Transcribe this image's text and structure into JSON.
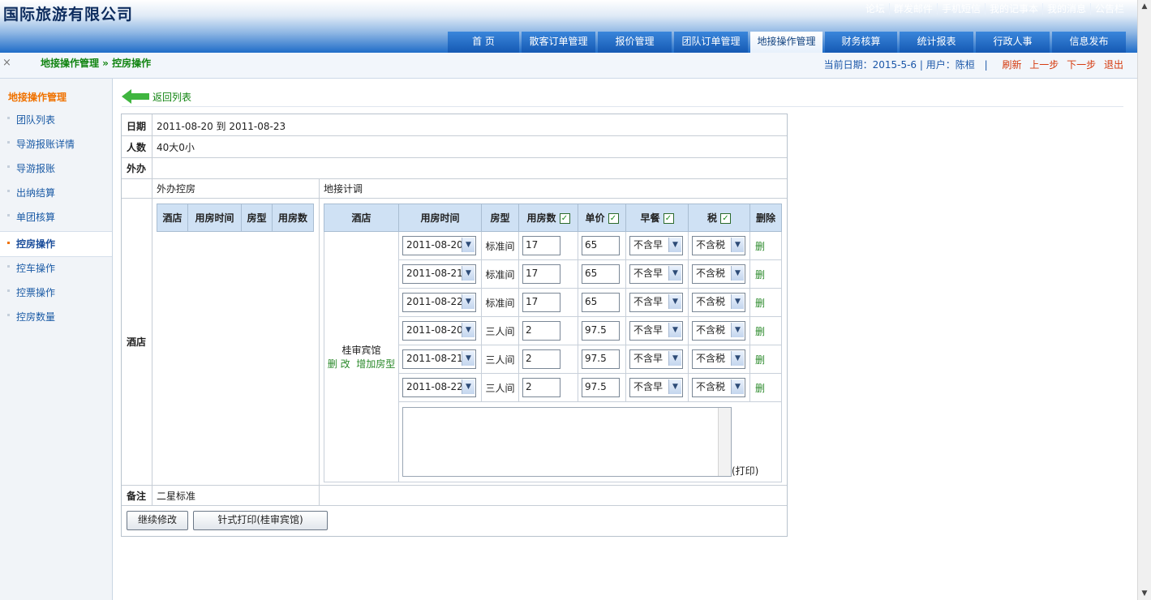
{
  "app": {
    "brand": "国际旅游有限公司"
  },
  "top_links": [
    "论坛",
    "群发邮件",
    "手机短信",
    "我的记事本",
    "我的消息",
    "公告栏"
  ],
  "nav": [
    {
      "label": "首 页"
    },
    {
      "label": "散客订单管理"
    },
    {
      "label": "报价管理"
    },
    {
      "label": "团队订单管理"
    },
    {
      "label": "地接操作管理",
      "active": true
    },
    {
      "label": "财务核算"
    },
    {
      "label": "统计报表"
    },
    {
      "label": "行政人事"
    },
    {
      "label": "信息发布"
    }
  ],
  "subbar": {
    "close": "×",
    "breadcrumb": "地接操作管理 » 控房操作",
    "date_label": "当前日期：2015-5-6 | 用户：陈桓",
    "sep": "|",
    "actions": [
      "刷新",
      "上一步",
      "下一步",
      "退出"
    ]
  },
  "sidebar": {
    "title": "地接操作管理",
    "items": [
      "团队列表",
      "导游报账详情",
      "导游报账",
      "出纳结算",
      "单团核算",
      "控房操作",
      "控车操作",
      "控票操作",
      "控房数量"
    ],
    "active_index": 5
  },
  "back": {
    "label": "返回列表"
  },
  "info": {
    "date_label": "日期",
    "date_value": "2011-08-20 到  2011-08-23",
    "people_label": "人数",
    "people_value": "40大0小",
    "outsource_label": "外办",
    "outsource_value": "",
    "wb_room_label": "外办控房",
    "dj_label": "地接计调",
    "hotel_label": "酒店",
    "remark_label": "备注",
    "remark_value": "二星标准"
  },
  "left_table": {
    "headers": [
      "酒店",
      "用房时间",
      "房型",
      "用房数"
    ]
  },
  "right_table": {
    "headers": [
      "酒店",
      "用房时间",
      "房型",
      "用房数",
      "单价",
      "早餐",
      "税",
      "删除"
    ],
    "hotel_name": "桂审宾馆",
    "hotel_links": [
      "删 改",
      "增加房型"
    ],
    "rows": [
      {
        "date": "2011-08-20",
        "type": "标准间",
        "count": "17",
        "price": "65",
        "breakfast": "不含早",
        "tax": "不含税",
        "del": "删"
      },
      {
        "date": "2011-08-21",
        "type": "标准间",
        "count": "17",
        "price": "65",
        "breakfast": "不含早",
        "tax": "不含税",
        "del": "删"
      },
      {
        "date": "2011-08-22",
        "type": "标准间",
        "count": "17",
        "price": "65",
        "breakfast": "不含早",
        "tax": "不含税",
        "del": "删"
      },
      {
        "date": "2011-08-20",
        "type": "三人间",
        "count": "2",
        "price": "97.5",
        "breakfast": "不含早",
        "tax": "不含税",
        "del": "删"
      },
      {
        "date": "2011-08-21",
        "type": "三人间",
        "count": "2",
        "price": "97.5",
        "breakfast": "不含早",
        "tax": "不含税",
        "del": "删"
      },
      {
        "date": "2011-08-22",
        "type": "三人间",
        "count": "2",
        "price": "97.5",
        "breakfast": "不含早",
        "tax": "不含税",
        "del": "删"
      }
    ],
    "print_label": "(打印)"
  },
  "buttons": {
    "continue": "继续修改",
    "print": "针式打印(桂审宾馆)"
  },
  "colors": {
    "nav_blue": "#1f6cc8",
    "accent_orange": "#f07200",
    "link_green": "#118411",
    "header_cell": "#cfe1f4"
  }
}
